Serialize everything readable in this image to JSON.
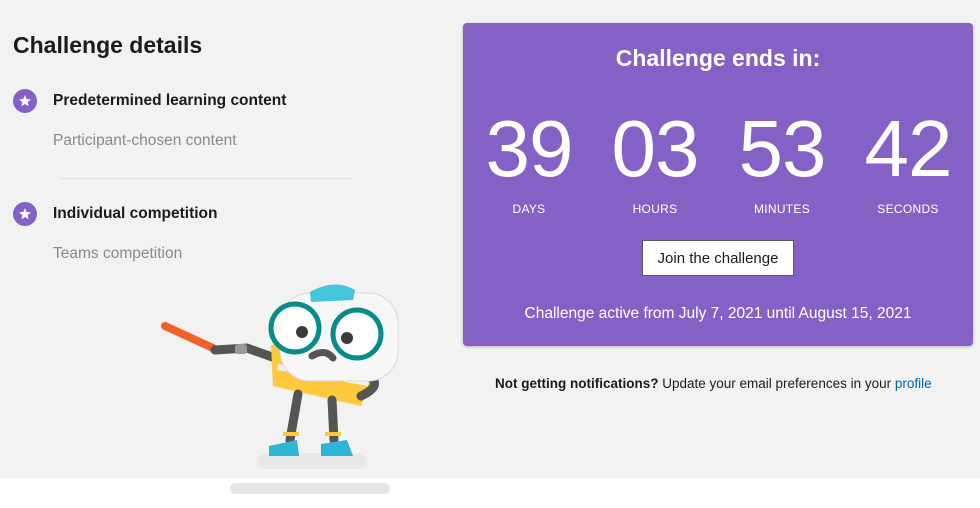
{
  "details": {
    "title": "Challenge details",
    "options": [
      {
        "selected": "Predetermined learning content",
        "alternative": "Participant-chosen content"
      },
      {
        "selected": "Individual competition",
        "alternative": "Teams competition"
      }
    ]
  },
  "countdown": {
    "title": "Challenge ends in:",
    "units": [
      {
        "value": "39",
        "label": "DAYS"
      },
      {
        "value": "03",
        "label": "HOURS"
      },
      {
        "value": "53",
        "label": "MINUTES"
      },
      {
        "value": "42",
        "label": "SECONDS"
      }
    ],
    "button_label": "Join the challenge",
    "active_text": "Challenge active from July 7, 2021 until August 15, 2021"
  },
  "notification": {
    "bold": "Not getting notifications?",
    "text": " Update your email preferences in your ",
    "link": "profile"
  },
  "icons": {
    "option_icon": "star-icon",
    "illustration": "mascot-illustration"
  },
  "colors": {
    "accent": "#8661c5",
    "link": "#0063b1",
    "background": "#f2f2f2"
  }
}
